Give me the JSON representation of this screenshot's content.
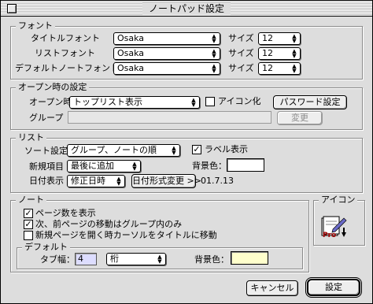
{
  "window": {
    "title": "ノートパッド設定"
  },
  "font_group": {
    "title": "フォント",
    "rows": [
      {
        "label": "タイトルフォント",
        "font": "Osaka",
        "size_label": "サイズ",
        "size": "12"
      },
      {
        "label": "リストフォント",
        "font": "Osaka",
        "size_label": "サイズ",
        "size": "12"
      },
      {
        "label": "デフォルトノートフォント",
        "font": "Osaka",
        "size_label": "サイズ",
        "size": "12"
      }
    ]
  },
  "open_group": {
    "title": "オープン時の設定",
    "open_label": "オープン時",
    "open_value": "トップリスト表示",
    "iconize_label": "アイコン化",
    "iconize_checked": false,
    "password_button": "パスワード設定",
    "group_label": "グループ",
    "group_value": "",
    "change_button": "変更"
  },
  "list_group": {
    "title": "リスト",
    "sort_label": "ソート設定",
    "sort_value": "グループ、ノートの順",
    "label_display_label": "ラベル表示",
    "label_display_checked": true,
    "new_item_label": "新規項目",
    "new_item_value": "最後に追加",
    "bg_color_label": "背景色：",
    "date_label": "日付表示",
    "date_value": "修正日時",
    "date_format_button": "日付形式変更 >>",
    "date_sample": "01.7.13"
  },
  "note_group": {
    "title": "ノート",
    "options": [
      {
        "label": "ページ数を表示",
        "checked": true
      },
      {
        "label": "次、前ページの移動はグループ内のみ",
        "checked": true
      },
      {
        "label": "新規ページを開く時カーソルをタイトルに移動",
        "checked": false
      }
    ],
    "default_group": {
      "title": "デフォルト",
      "tab_width_label": "タブ幅：",
      "tab_width_value": "4",
      "unit_value": "桁",
      "bg_color_label": "背景色："
    }
  },
  "icon_group": {
    "title": "アイコン",
    "icon": "pro-notepad-icon"
  },
  "buttons": {
    "cancel": "キャンセル",
    "ok": "設定"
  },
  "colors": {
    "list_bg": "#ffffff",
    "note_bg": "#ffffcc",
    "tab_field_bg": "#ddddff"
  }
}
